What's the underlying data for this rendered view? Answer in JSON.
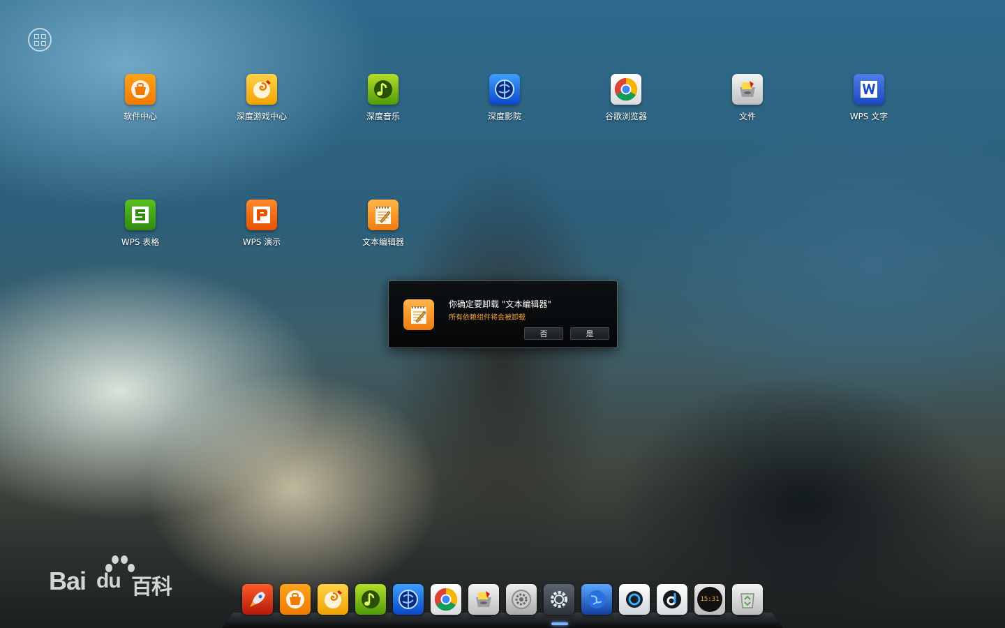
{
  "launcher": {
    "row1": [
      {
        "label": "软件中心",
        "icon": "software-center-icon"
      },
      {
        "label": "深度游戏中心",
        "icon": "game-center-icon"
      },
      {
        "label": "深度音乐",
        "icon": "music-icon"
      },
      {
        "label": "深度影院",
        "icon": "movie-icon"
      },
      {
        "label": "谷歌浏览器",
        "icon": "chrome-icon"
      },
      {
        "label": "文件",
        "icon": "file-manager-icon"
      },
      {
        "label": "WPS 文字",
        "icon": "wps-writer-icon"
      }
    ],
    "row2": [
      {
        "label": "WPS 表格",
        "icon": "wps-spreadsheet-icon"
      },
      {
        "label": "WPS 演示",
        "icon": "wps-presentation-icon"
      },
      {
        "label": "文本编辑器",
        "icon": "text-editor-icon"
      }
    ]
  },
  "dialog": {
    "title": "你确定要卸载 \"文本编辑器\"",
    "subtitle": "所有依赖组件将会被卸载",
    "no_label": "否",
    "yes_label": "是",
    "subtitle_color": "#f3a53a"
  },
  "dock": {
    "clock_text": "15:31",
    "items": [
      "launcher-rocket-icon",
      "software-center-icon",
      "game-center-icon",
      "music-icon",
      "movie-icon",
      "chrome-icon",
      "file-manager-icon",
      "system-settings-icon",
      "settings-gear-icon",
      "browser-globe-icon",
      "media-ring-icon",
      "deepin-d-icon",
      "clock-icon",
      "trash-icon"
    ]
  },
  "watermark": {
    "brand_latin": "Bai",
    "brand_du": "du",
    "brand_cn": "百科"
  }
}
